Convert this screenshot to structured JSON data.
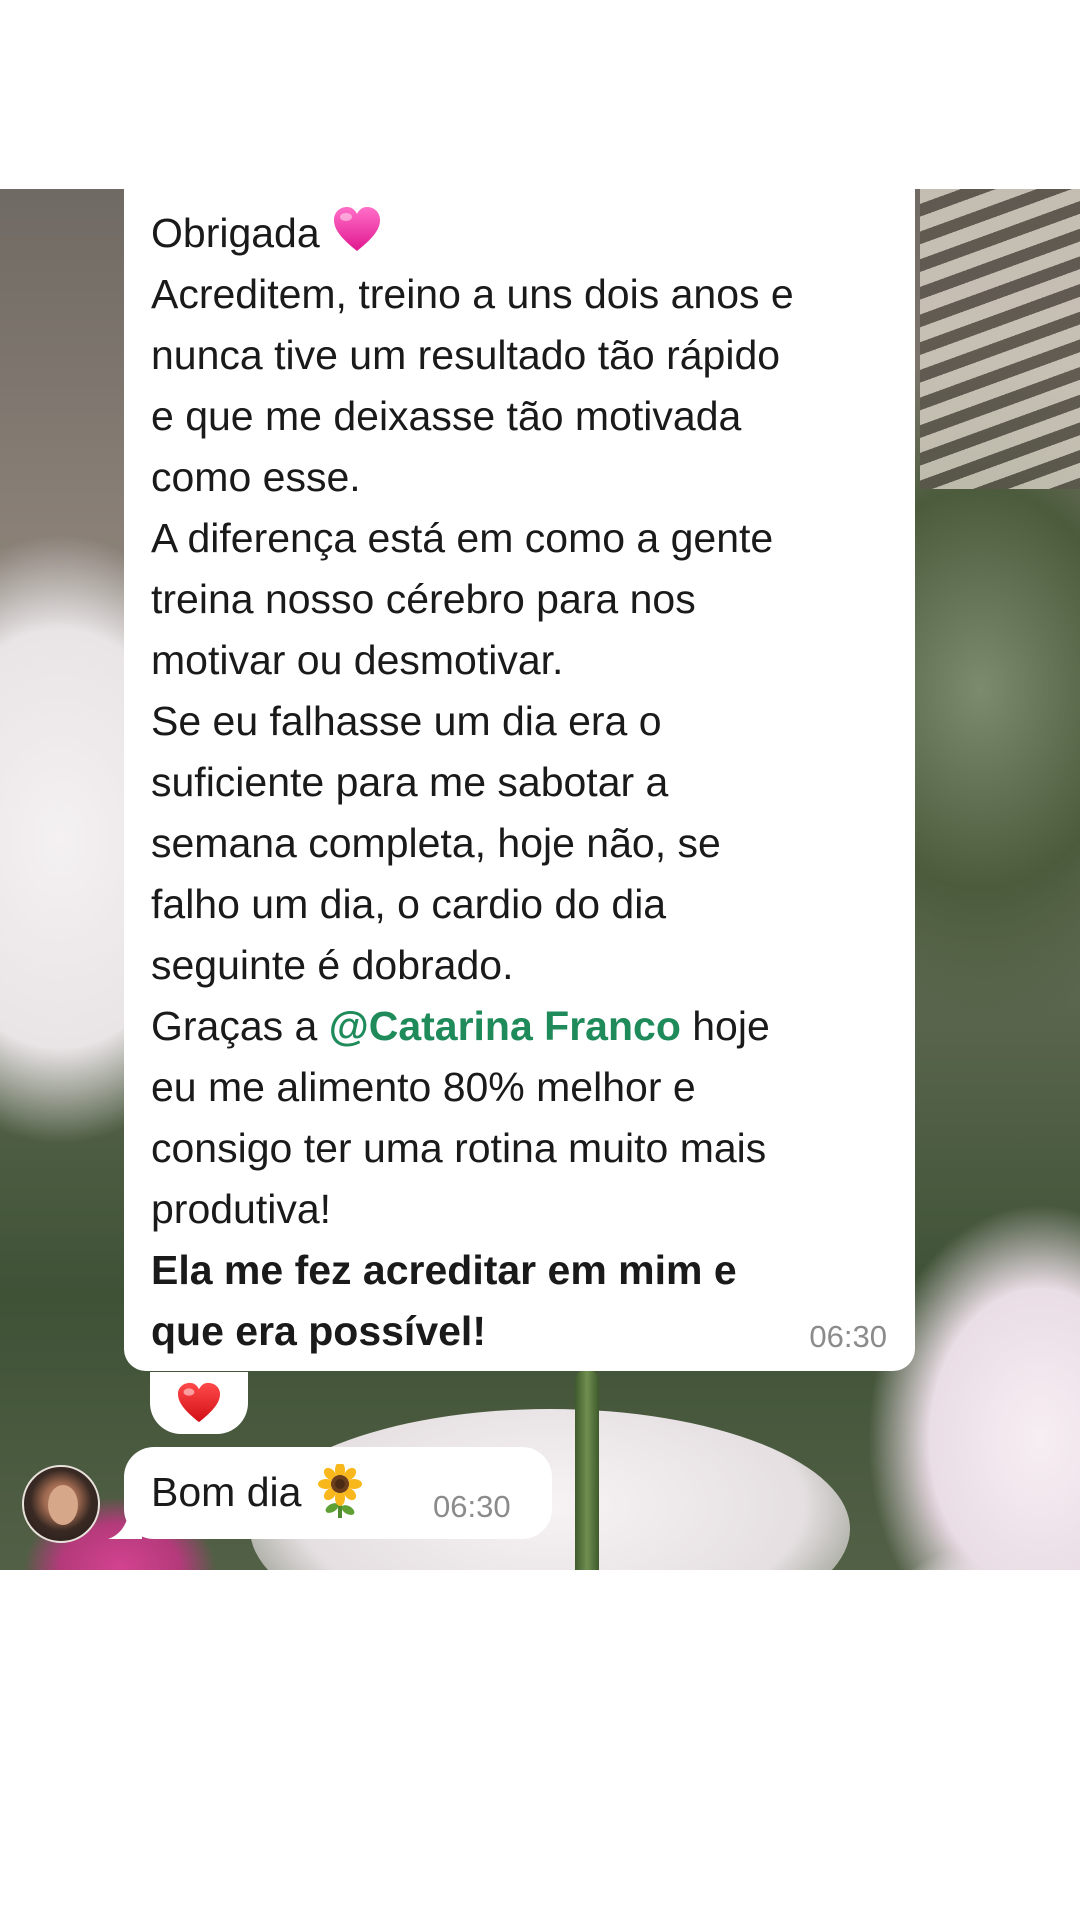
{
  "conversation": {
    "message_main": {
      "lines": [
        "Obrigada",
        "Acreditem, treino a uns dois anos e",
        "nunca tive um resultado tão rápido",
        "e que me deixasse tão motivada",
        "como esse.",
        "A diferença está em como a gente",
        "treina nosso cérebro para nos",
        "motivar ou desmotivar.",
        "Se eu falhasse um dia era o",
        "suficiente para me sabotar a",
        "semana completa, hoje não, se",
        "falho um dia, o cardio do dia",
        "seguinte é dobrado."
      ],
      "mention_prefix": "Graças a ",
      "mention": "@Catarina Franco",
      "mention_suffix": " hoje",
      "lines_after": [
        "eu me alimento 80% melhor e",
        "consigo ter uma rotina muito mais",
        "produtiva!"
      ],
      "bold_lines": [
        "Ela me fez acreditar em mim e",
        "que era possível!"
      ],
      "time": "06:30",
      "emoji": "pink-heart-icon"
    },
    "reaction": {
      "emoji": "red-heart-icon"
    },
    "message_second": {
      "text": "Bom dia",
      "emoji": "sunflower-icon",
      "time": "06:30"
    }
  },
  "colors": {
    "mention": "#1f8a5a",
    "timestamp": "#8b8b8b",
    "bubble": "#ffffff"
  }
}
